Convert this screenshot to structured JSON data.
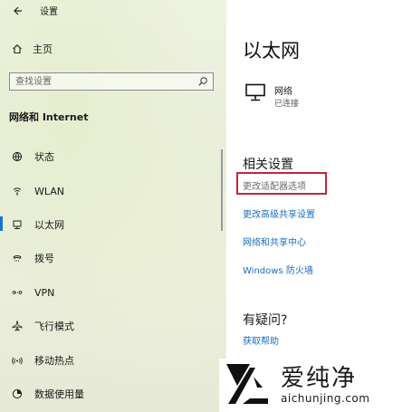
{
  "window": {
    "back_label": "设置"
  },
  "sidebar": {
    "home_label": "主页",
    "search_placeholder": "查找设置",
    "section_title": "网络和 Internet",
    "items": [
      {
        "label": "状态",
        "icon": "globe-icon",
        "active": false
      },
      {
        "label": "WLAN",
        "icon": "wifi-icon",
        "active": false
      },
      {
        "label": "以太网",
        "icon": "ethernet-icon",
        "active": true
      },
      {
        "label": "拨号",
        "icon": "dialup-icon",
        "active": false
      },
      {
        "label": "VPN",
        "icon": "vpn-icon",
        "active": false
      },
      {
        "label": "飞行模式",
        "icon": "airplane-icon",
        "active": false
      },
      {
        "label": "移动热点",
        "icon": "hotspot-icon",
        "active": false
      },
      {
        "label": "数据使用量",
        "icon": "data-usage-icon",
        "active": false
      }
    ]
  },
  "main": {
    "title": "以太网",
    "network": {
      "name": "网络",
      "status": "已连接"
    },
    "related_settings": {
      "title": "相关设置",
      "links": [
        "更改适配器选项",
        "更改高级共享设置",
        "网络和共享中心",
        "Windows 防火墙"
      ]
    },
    "help": {
      "title": "有疑问?",
      "link": "获取帮助"
    }
  },
  "watermark": {
    "name": "爱纯净",
    "url": "aichunjing.com"
  },
  "colors": {
    "accent": "#1a73c8",
    "link": "#1a6fc1",
    "highlight_border": "#c0273a"
  }
}
